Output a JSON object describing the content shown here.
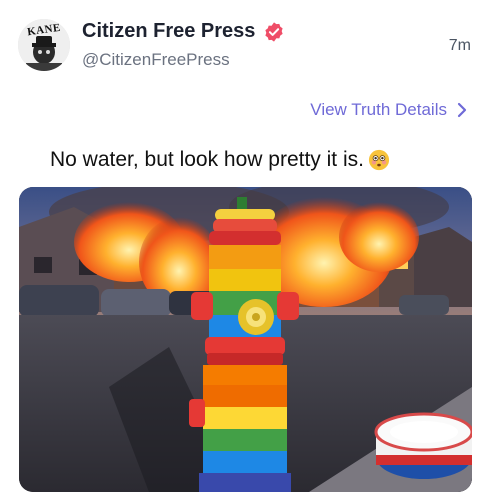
{
  "post": {
    "avatar_text": "KANE",
    "author": "Citizen Free Press",
    "handle": "@CitizenFreePress",
    "time": "7m",
    "view_link": "View Truth Details",
    "caption": "No water, but look how pretty it is."
  },
  "icons": {
    "verified": "verified-badge-icon",
    "chevron": "chevron-right-icon",
    "emoji": "flushed-face-emoji-icon"
  },
  "colors": {
    "verified_badge": "#ef4d67",
    "link": "#6f6ad7",
    "handle": "#6b7280"
  }
}
